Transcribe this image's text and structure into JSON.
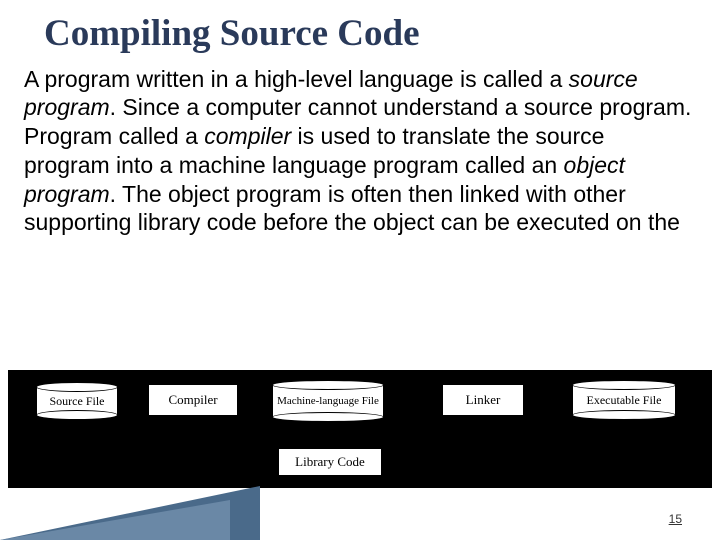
{
  "title": "Compiling Source Code",
  "paragraph": {
    "p1": "A program written in a high-level language is called a ",
    "i1": "source program",
    "p2": ". Since a computer cannot understand a source program. Program called a ",
    "i2": "compiler",
    "p3": " is used to translate the source program into a machine language program called an ",
    "i3": "object program",
    "p4": ". The object program is often then linked with other supporting library code before the object can be executed on the"
  },
  "diagram": {
    "source_file": "Source File",
    "compiler": "Compiler",
    "machine_lang_file": "Machine-language File",
    "linker": "Linker",
    "executable_file": "Executable File",
    "library_code": "Library Code"
  },
  "page_number": "15"
}
